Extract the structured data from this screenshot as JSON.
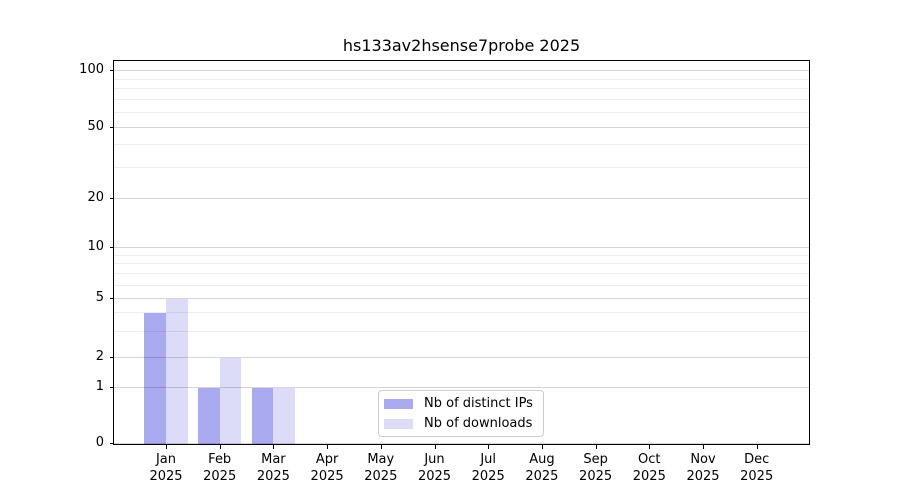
{
  "title": "hs133av2hsense7probe 2025",
  "chart_data": {
    "type": "bar",
    "title": "hs133av2hsense7probe 2025",
    "categories": [
      "Jan",
      "Feb",
      "Mar",
      "Apr",
      "May",
      "Jun",
      "Jul",
      "Aug",
      "Sep",
      "Oct",
      "Nov",
      "Dec"
    ],
    "year": "2025",
    "series": [
      {
        "key": "distinct-ips",
        "name": "Nb of distinct IPs",
        "color": "#aaaaf0",
        "values": [
          4,
          1,
          1,
          0,
          0,
          0,
          0,
          0,
          0,
          0,
          0,
          0
        ]
      },
      {
        "key": "downloads",
        "name": "Nb of downloads",
        "color": "#dcdcf8",
        "values": [
          5,
          2,
          1,
          0,
          0,
          0,
          0,
          0,
          0,
          0,
          0,
          0
        ]
      }
    ],
    "ylabel": "",
    "xlabel": "",
    "yscale": "symlog",
    "ylim": [
      0,
      110
    ],
    "y_major_ticks": [
      0,
      1,
      2,
      5,
      10,
      20,
      50,
      100
    ],
    "y_minor_ticks": [
      3,
      4,
      6,
      7,
      8,
      9,
      30,
      40,
      60,
      70,
      80,
      90
    ],
    "grid": true,
    "legend_position": "lower-center"
  }
}
